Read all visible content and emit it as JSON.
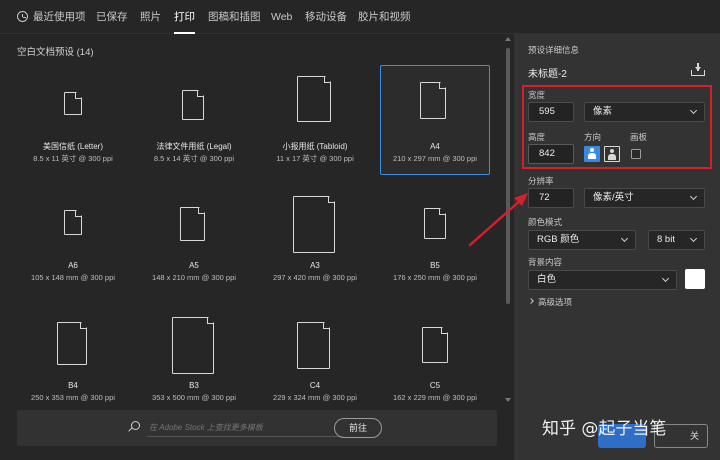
{
  "tabs": [
    {
      "label": "最近使用项",
      "active": false
    },
    {
      "label": "已保存",
      "active": false
    },
    {
      "label": "照片",
      "active": false
    },
    {
      "label": "打印",
      "active": true
    },
    {
      "label": "图稿和插图",
      "active": false
    },
    {
      "label": "Web",
      "active": false
    },
    {
      "label": "移动设备",
      "active": false
    },
    {
      "label": "胶片和视频",
      "active": false
    }
  ],
  "presets": {
    "section_title": "空白文档预设 (14)",
    "items": [
      {
        "name": "美国信纸 (Letter)",
        "size": "8.5 x 11 英寸 @ 300 ppi"
      },
      {
        "name": "法律文件用纸 (Legal)",
        "size": "8.5 x 14 英寸 @ 300 ppi"
      },
      {
        "name": "小报用纸 (Tabloid)",
        "size": "11 x 17 英寸 @ 300 ppi"
      },
      {
        "name": "A4",
        "size": "210 x 297 mm @ 300 ppi"
      },
      {
        "name": "A6",
        "size": "105 x 148 mm @ 300 ppi"
      },
      {
        "name": "A5",
        "size": "148 x 210 mm @ 300 ppi"
      },
      {
        "name": "A3",
        "size": "297 x 420 mm @ 300 ppi"
      },
      {
        "name": "B5",
        "size": "176 x 250 mm @ 300 ppi"
      },
      {
        "name": "B4",
        "size": "250 x 353 mm @ 300 ppi"
      },
      {
        "name": "B3",
        "size": "353 x 500 mm @ 300 ppi"
      },
      {
        "name": "C4",
        "size": "229 x 324 mm @ 300 ppi"
      },
      {
        "name": "C5",
        "size": "162 x 229 mm @ 300 ppi"
      }
    ]
  },
  "stock": {
    "placeholder": "在 Adobe Stock 上查找更多模板",
    "go_label": "前往"
  },
  "details": {
    "header": "预设详细信息",
    "doc_title": "未标题-2",
    "width_label": "宽度",
    "width_value": "595",
    "width_unit": "像素",
    "height_label": "高度",
    "height_value": "842",
    "orientation_label": "方向",
    "artboard_label": "画板",
    "resolution_label": "分辨率",
    "resolution_value": "72",
    "resolution_unit": "像素/英寸",
    "color_mode_label": "颜色模式",
    "color_mode_value": "RGB 颜色",
    "bit_depth": "8 bit",
    "background_label": "背景内容",
    "background_value": "白色",
    "advanced_label": "高级选项"
  },
  "colors": {
    "selection_blue": "#3d8ee6",
    "highlight_red": "#d4202a",
    "panel_bg": "#333333",
    "main_bg": "#262626"
  },
  "watermark": {
    "text": "知乎 @起子当笔",
    "button_label": "关"
  }
}
